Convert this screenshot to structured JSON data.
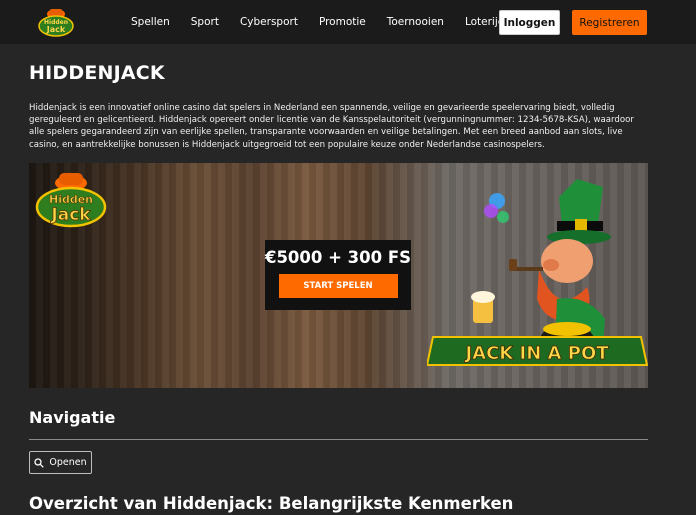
{
  "header": {
    "logo_alt": "Hidden Jack",
    "nav": [
      "Spellen",
      "Sport",
      "Cybersport",
      "Promotie",
      "Toernooien",
      "Loterijen"
    ],
    "login_label": "Inloggen",
    "register_label": "Registreren"
  },
  "main": {
    "title": "HIDDENJACK",
    "intro": "Hiddenjack is een innovatief online casino dat spelers in Nederland een spannende, veilige en gevarieerde speelervaring biedt, volledig gereguleerd en gelicentieerd. Hiddenjack opereert onder licentie van de Kansspelautoriteit (vergunningnummer: 1234-5678-KSA), waardoor alle spelers gegarandeerd zijn van eerlijke spellen, transparante voorwaarden en veilige betalingen. Met een breed aanbod aan slots, live casino, en aantrekkelijke bonussen is Hiddenjack uitgegroeid tot een populaire keuze onder Nederlandse casinospelers."
  },
  "banner": {
    "offer": "€5000 + 300 FS",
    "cta_label": "START SPELEN",
    "game_logo": "JACK IN A POT"
  },
  "navigatie": {
    "title": "Navigatie",
    "open_label": "Openen"
  },
  "section": {
    "title": "Overzicht van Hiddenjack: Belangrijkste Kenmerken"
  },
  "colors": {
    "accent": "#ff6a00",
    "background": "#262626",
    "header": "#1b1b1b"
  }
}
